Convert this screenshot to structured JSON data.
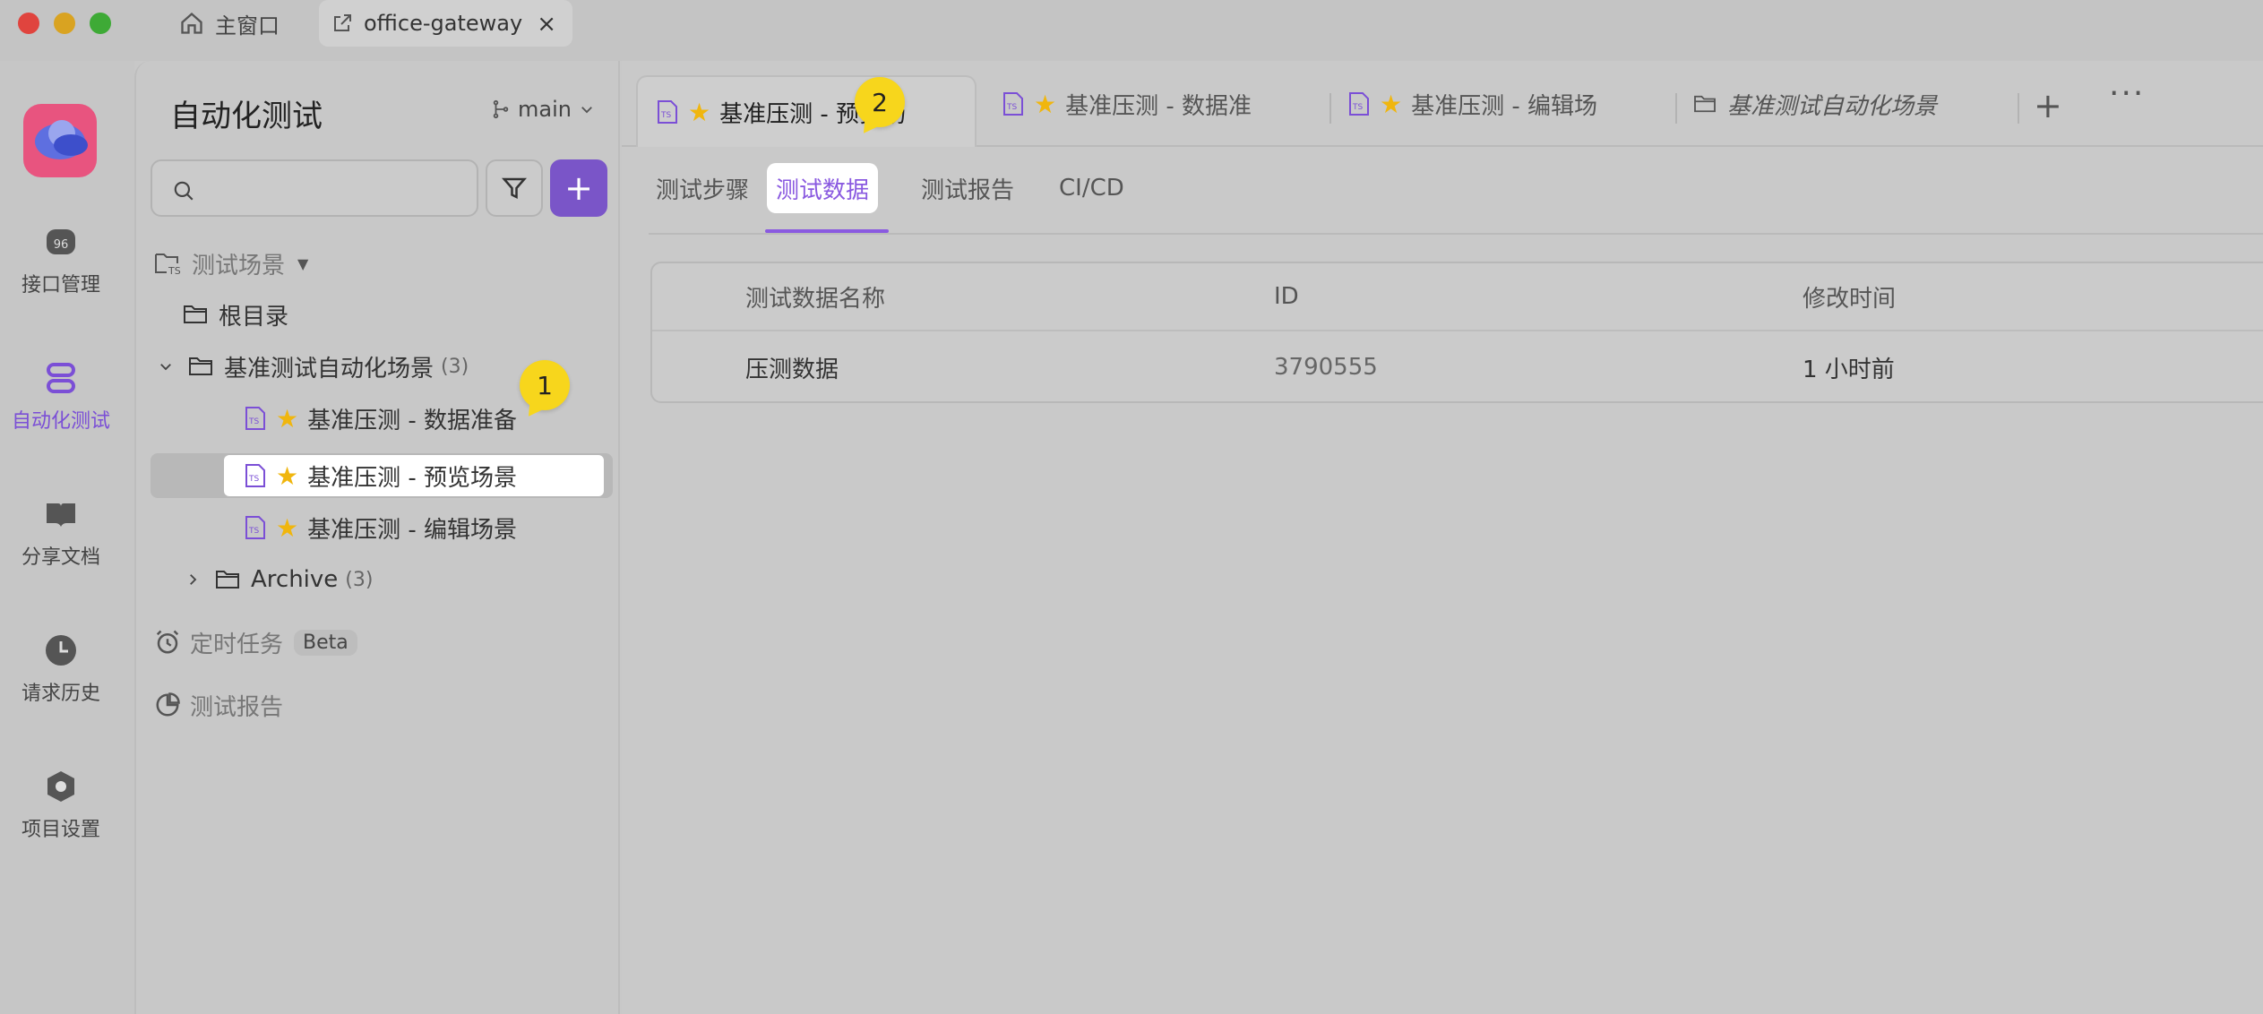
{
  "window": {
    "tabs": [
      {
        "label": "主窗口",
        "icon": "home-icon"
      },
      {
        "label": "office-gateway",
        "icon": "external-link-icon",
        "close": "×"
      }
    ]
  },
  "rail": {
    "items": [
      {
        "label": "接口管理",
        "icon": "api-icon"
      },
      {
        "label": "自动化测试",
        "icon": "automation-icon",
        "active": true
      },
      {
        "label": "分享文档",
        "icon": "book-icon"
      },
      {
        "label": "请求历史",
        "icon": "clock-icon"
      },
      {
        "label": "项目设置",
        "icon": "settings-hex-icon"
      }
    ]
  },
  "sidebar": {
    "title": "自动化测试",
    "branch": "main",
    "search_placeholder": "",
    "add_label": "+",
    "scenarios_header": "测试场景",
    "root_label": "根目录",
    "folder": {
      "label": "基准测试自动化场景",
      "count": "(3)"
    },
    "items": [
      {
        "label": "基准压测 - 数据准备"
      },
      {
        "label": "基准压测 - 预览场景"
      },
      {
        "label": "基准压测 - 编辑场景"
      }
    ],
    "archive": {
      "label": "Archive",
      "count": "(3)"
    },
    "scheduled": {
      "label": "定时任务",
      "badge": "Beta"
    },
    "reports": {
      "label": "测试报告"
    }
  },
  "doc_tabs": [
    {
      "label": "基准压测 - 预览场",
      "active": true
    },
    {
      "label": "基准压测 - 数据准"
    },
    {
      "label": "基准压测 - 编辑场"
    },
    {
      "label": "基准测试自动化场景"
    }
  ],
  "doc_tab_actions": {
    "add": "+",
    "more": "···"
  },
  "sub_tabs": [
    {
      "label": "测试步骤"
    },
    {
      "label": "测试数据",
      "active": true
    },
    {
      "label": "测试报告"
    },
    {
      "label": "CI/CD"
    }
  ],
  "table": {
    "columns": [
      "测试数据名称",
      "ID",
      "修改时间"
    ],
    "rows": [
      [
        "压测数据",
        "3790555",
        "1 小时前"
      ]
    ]
  },
  "markers": [
    "1",
    "2"
  ],
  "colors": {
    "accent": "#7a55c8",
    "star": "#f0b60e",
    "marker": "#f7d61c"
  }
}
